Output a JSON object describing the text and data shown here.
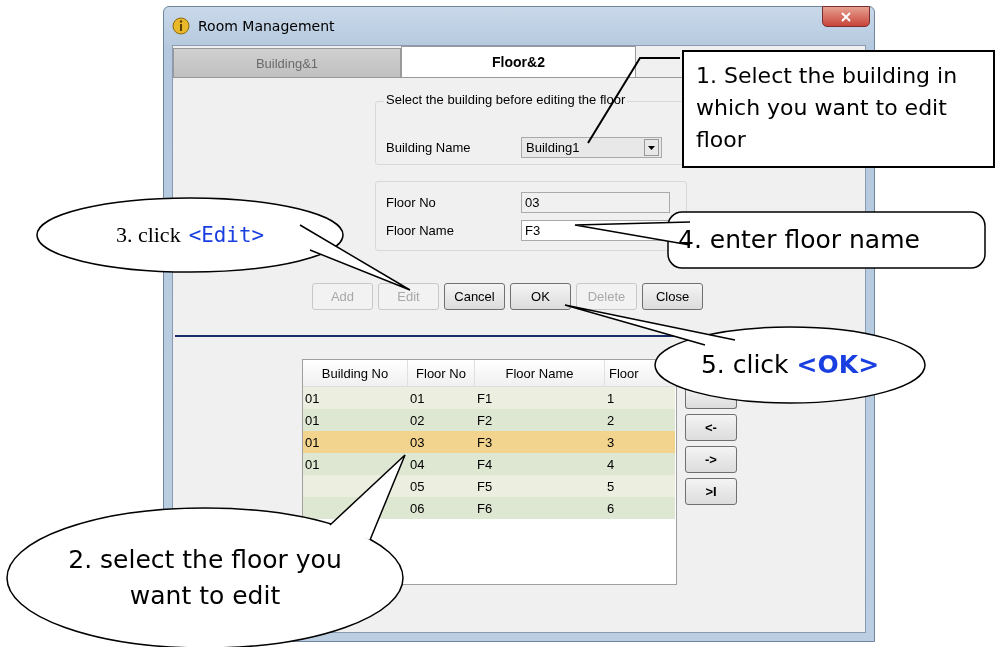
{
  "window": {
    "title": "Room Management"
  },
  "tabs": [
    {
      "label": "Building&1",
      "selected": false
    },
    {
      "label": "Floor&2",
      "selected": true
    }
  ],
  "building_group": {
    "legend": "Select the building before editing the floor",
    "label": "Building Name",
    "value": "Building1"
  },
  "floor_group": {
    "floor_no_label": "Floor No",
    "floor_no_value": "03",
    "floor_name_label": "Floor Name",
    "floor_name_value": "F3"
  },
  "buttons": [
    {
      "label": "Add",
      "disabled": true
    },
    {
      "label": "Edit",
      "disabled": true
    },
    {
      "label": "Cancel",
      "disabled": false
    },
    {
      "label": "OK",
      "disabled": false
    },
    {
      "label": "Delete",
      "disabled": true
    },
    {
      "label": "Close",
      "disabled": false
    }
  ],
  "table": {
    "columns": [
      "Building No",
      "Floor No",
      "Floor Name",
      "Floor"
    ],
    "rows": [
      {
        "building_no": "01",
        "floor_no": "01",
        "floor_name": "F1",
        "column_4": "1",
        "selected": false
      },
      {
        "building_no": "01",
        "floor_no": "02",
        "floor_name": "F2",
        "column_4": "2",
        "selected": false
      },
      {
        "building_no": "01",
        "floor_no": "03",
        "floor_name": "F3",
        "column_4": "3",
        "selected": true
      },
      {
        "building_no": "01",
        "floor_no": "04",
        "floor_name": "F4",
        "column_4": "4",
        "selected": false
      },
      {
        "floor_no": "05",
        "floor_name": "F5",
        "column_4": "5",
        "selected": false
      },
      {
        "floor_no": "06",
        "floor_name": "F6",
        "column_4": "6",
        "selected": false
      }
    ]
  },
  "nav_buttons": [
    "<-",
    "->",
    ">I"
  ],
  "callouts": [
    {
      "kind": "box",
      "text": "1. Select the building in which you want to edit floor"
    },
    {
      "kind": "ellipse",
      "text": "3. click",
      "keyword": "<Edit>"
    },
    {
      "kind": "rounded",
      "text": "4. enter floor name"
    },
    {
      "kind": "ellipse",
      "text": "5. click",
      "keyword": "<OK>"
    },
    {
      "kind": "ellipse",
      "text": "2. select the floor you want to edit"
    }
  ]
}
